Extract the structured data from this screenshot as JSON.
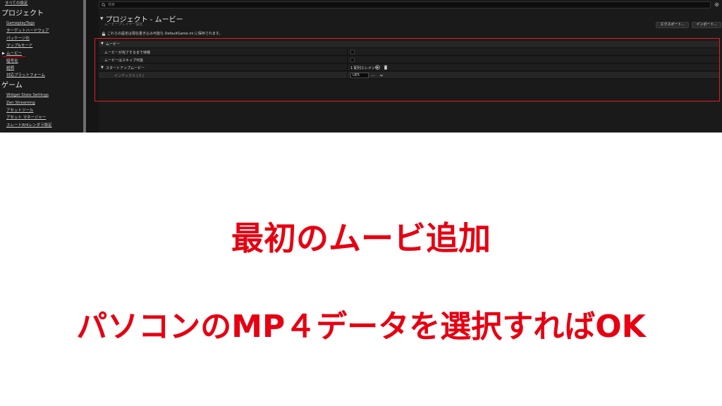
{
  "sidebar": {
    "all_settings": "すべての設定",
    "categories": [
      {
        "title": "プロジェクト",
        "items": [
          "GameplayTags",
          "ターゲットハードウェア",
          "パッケージ化",
          "マップ&モード",
          "ムービー",
          "暗号化",
          "説明",
          "対応プラットフォーム"
        ]
      },
      {
        "title": "ゲーム",
        "items": [
          "Widget State Settings",
          "Zen Streaming",
          "アセットツール",
          "アセット マネージャー",
          "スレートRHIレンダラ設定"
        ]
      }
    ]
  },
  "search": {
    "placeholder": "検索"
  },
  "header": {
    "title": "プロジェクト - ムービー",
    "subtitle": "ムービープレイヤー設定",
    "export_label": "エクスポート...",
    "import_label": "インポート...",
    "info": "これらの設定は現在書き込み可能な DefaultGame.ini に保存されます。"
  },
  "section": {
    "title": "ムービー",
    "rows": {
      "wait_label": "ムービーが完了するまで待機",
      "skip_label": "ムービーはスキップ可能",
      "startup_label": "スタートアップムービー",
      "array_count": "1 配列エレメント",
      "index_label": "インデックス [ 0 ]",
      "index_value": "UE5",
      "browse_label": "..."
    }
  },
  "caption": {
    "line1": "最初のムービ追加",
    "line2": "パソコンのMP４データを選択すればOK"
  },
  "colors": {
    "highlight": "#e31e1e",
    "caption": "#e60012",
    "panel": "#1a1a1a"
  }
}
